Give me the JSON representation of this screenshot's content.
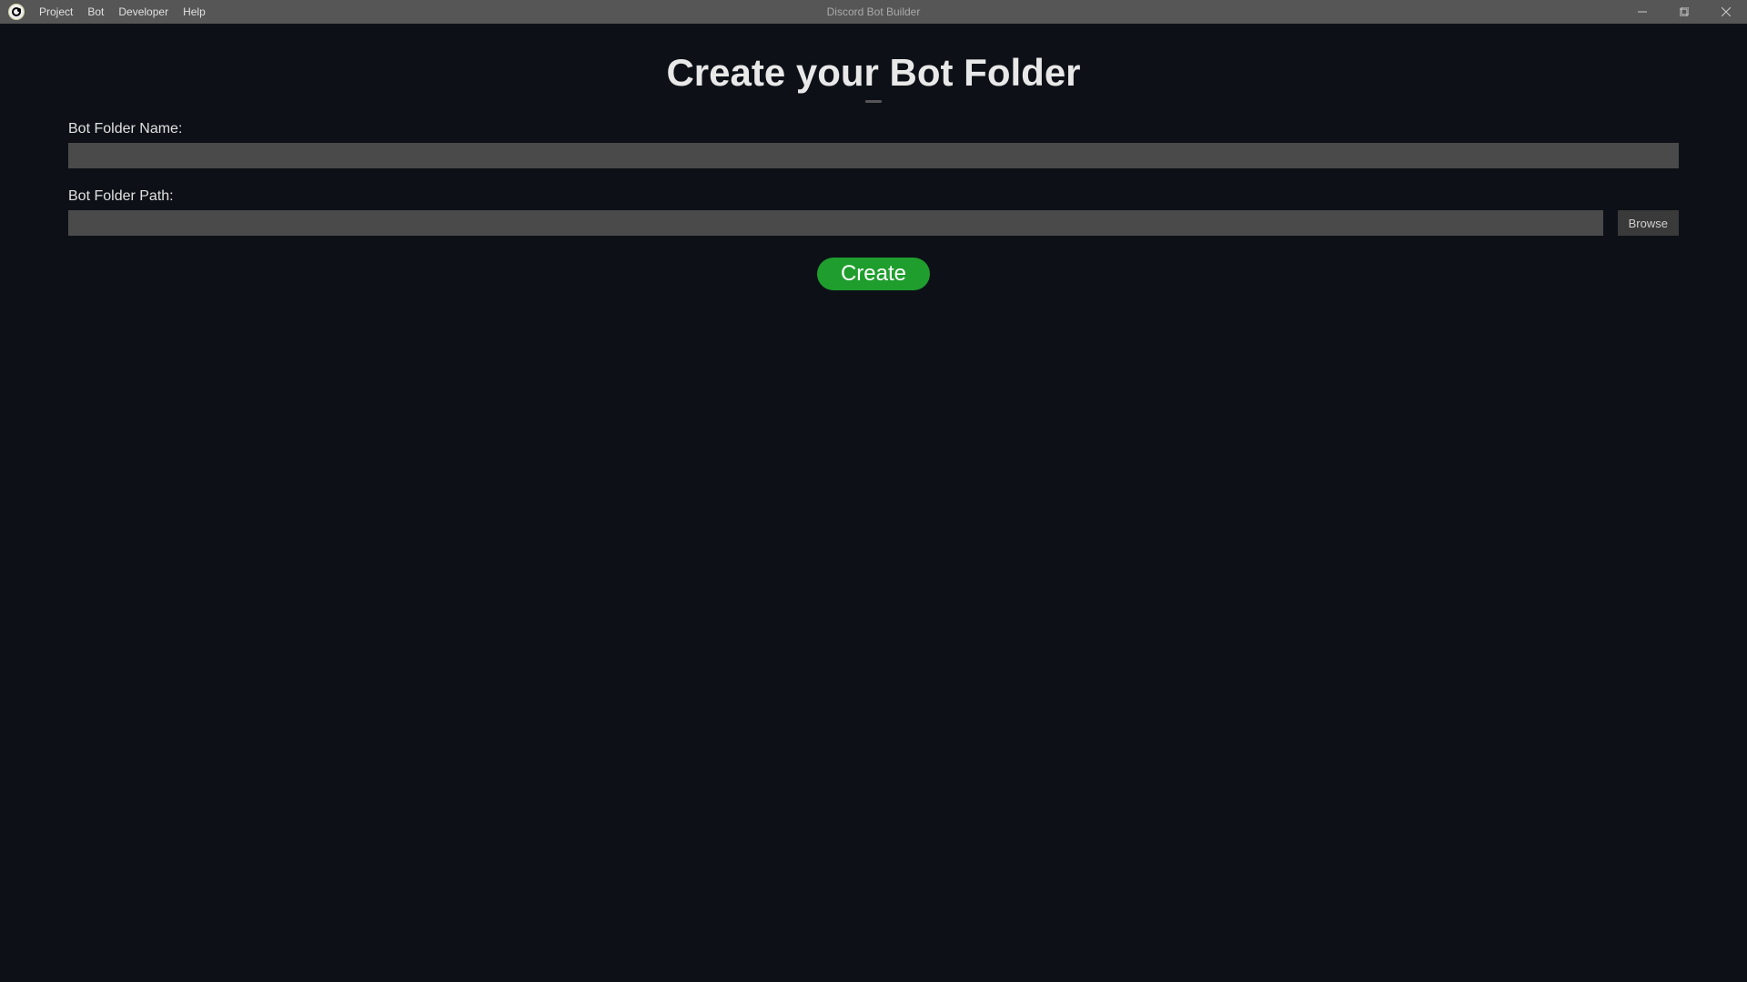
{
  "window": {
    "title": "Discord Bot Builder"
  },
  "menu": {
    "items": [
      "Project",
      "Bot",
      "Developer",
      "Help"
    ]
  },
  "page": {
    "title": "Create your Bot Folder"
  },
  "form": {
    "folder_name": {
      "label": "Bot Folder Name:",
      "value": ""
    },
    "folder_path": {
      "label": "Bot Folder Path:",
      "value": "",
      "browse_label": "Browse"
    },
    "create_label": "Create"
  }
}
